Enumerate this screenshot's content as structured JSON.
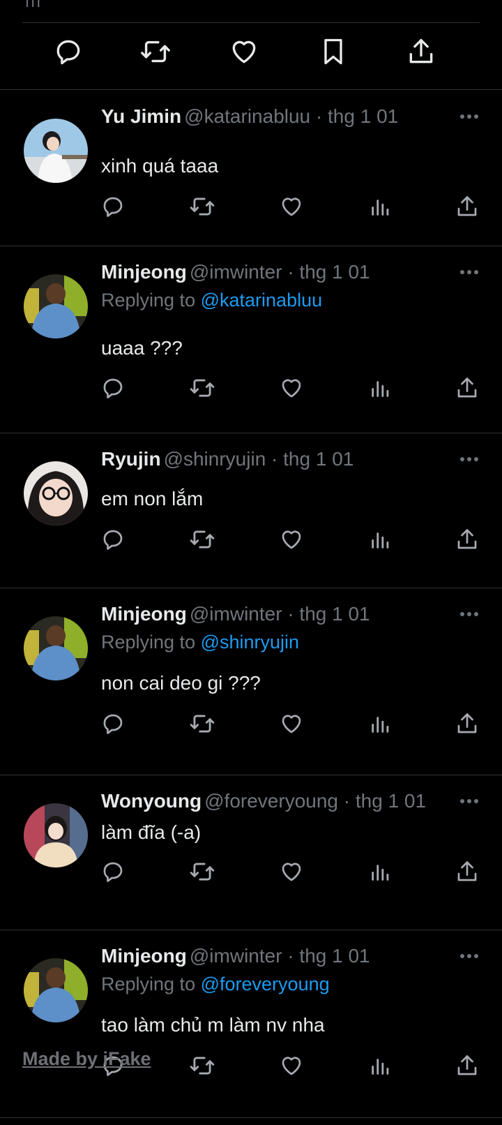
{
  "top": {
    "fragment": "ııı",
    "actions": [
      {
        "name": "reply-icon"
      },
      {
        "name": "retweet-icon"
      },
      {
        "name": "like-icon"
      },
      {
        "name": "bookmark-icon"
      },
      {
        "name": "share-icon"
      }
    ]
  },
  "replies": [
    {
      "name": "Yu Jimin",
      "handle": "@katarinabluu · thg 1 01",
      "replying_label": "",
      "replying_to": "",
      "text": "xinh quá taaa",
      "avatar": "avatar-yu-jimin"
    },
    {
      "name": "Minjeong",
      "handle": "@imwinter · thg 1 01",
      "replying_label": "Replying to",
      "replying_to": "@katarinabluu",
      "text": "uaaa ???",
      "avatar": "avatar-minjeong"
    },
    {
      "name": "Ryujin",
      "handle": "@shinryujin · thg 1 01",
      "replying_label": "",
      "replying_to": "",
      "text": "em non lắm",
      "avatar": "avatar-ryujin"
    },
    {
      "name": "Minjeong",
      "handle": "@imwinter · thg 1 01",
      "replying_label": "Replying to",
      "replying_to": "@shinryujin",
      "text": "non cai deo gi ???",
      "avatar": "avatar-minjeong"
    },
    {
      "name": "Wonyoung",
      "handle": "@foreveryoung · thg 1 01",
      "replying_label": "",
      "replying_to": "",
      "text": "làm đĩa (-a)",
      "avatar": "avatar-wonyoung"
    },
    {
      "name": "Minjeong",
      "handle": "@imwinter · thg 1 01",
      "replying_label": "Replying to",
      "replying_to": "@foreveryoung",
      "text": "tao làm chủ m làm nv nha",
      "avatar": "avatar-minjeong"
    }
  ],
  "watermark": "Made by iFake",
  "colors": {
    "background": "#000000",
    "text": "#e7e9ea",
    "muted": "#71767b",
    "link": "#1d9bf0",
    "divider": "#2f3336"
  }
}
